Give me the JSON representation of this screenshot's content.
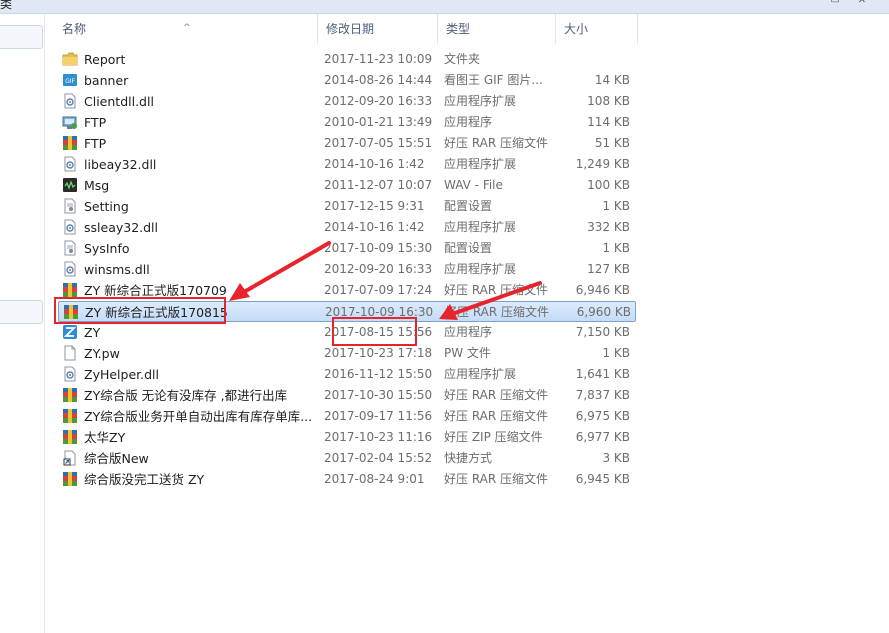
{
  "window": {
    "title_fragment": "类"
  },
  "columns": {
    "name": "名称",
    "date": "修改日期",
    "type": "类型",
    "size": "大小"
  },
  "files": [
    {
      "name": "Report",
      "date": "2017-11-23 10:09",
      "type": "文件夹",
      "size": "",
      "icon": "folder-icon"
    },
    {
      "name": "banner",
      "date": "2014-08-26 14:44",
      "type": "看图王 GIF 图片...",
      "size": "14 KB",
      "icon": "gif-icon"
    },
    {
      "name": "Clientdll.dll",
      "date": "2012-09-20 16:33",
      "type": "应用程序扩展",
      "size": "108 KB",
      "icon": "dll-icon"
    },
    {
      "name": "FTP",
      "date": "2010-01-21 13:49",
      "type": "应用程序",
      "size": "114 KB",
      "icon": "exe-icon"
    },
    {
      "name": "FTP",
      "date": "2017-07-05 15:51",
      "type": "好压 RAR 压缩文件",
      "size": "51 KB",
      "icon": "rar-icon"
    },
    {
      "name": "libeay32.dll",
      "date": "2014-10-16 1:42",
      "type": "应用程序扩展",
      "size": "1,249 KB",
      "icon": "dll-icon"
    },
    {
      "name": "Msg",
      "date": "2011-12-07 10:07",
      "type": "WAV - File",
      "size": "100 KB",
      "icon": "wav-icon"
    },
    {
      "name": "Setting",
      "date": "2017-12-15 9:31",
      "type": "配置设置",
      "size": "1 KB",
      "icon": "ini-icon"
    },
    {
      "name": "ssleay32.dll",
      "date": "2014-10-16 1:42",
      "type": "应用程序扩展",
      "size": "332 KB",
      "icon": "dll-icon"
    },
    {
      "name": "SysInfo",
      "date": "2017-10-09 15:30",
      "type": "配置设置",
      "size": "1 KB",
      "icon": "ini-icon"
    },
    {
      "name": "winsms.dll",
      "date": "2012-09-20 16:33",
      "type": "应用程序扩展",
      "size": "127 KB",
      "icon": "dll-icon"
    },
    {
      "name": "ZY 新综合正式版170709",
      "date": "2017-07-09 17:24",
      "type": "好压 RAR 压缩文件",
      "size": "6,946 KB",
      "icon": "rar-icon"
    },
    {
      "name": "ZY 新综合正式版170815",
      "date": "2017-10-09 16:30",
      "type": "好压 RAR 压缩文件",
      "size": "6,960 KB",
      "icon": "rar-icon",
      "selected": true
    },
    {
      "name": "ZY",
      "date": "2017-08-15 15:56",
      "type": "应用程序",
      "size": "7,150 KB",
      "icon": "zy-app-icon"
    },
    {
      "name": "ZY.pw",
      "date": "2017-10-23 17:18",
      "type": "PW 文件",
      "size": "1 KB",
      "icon": "blank-file-icon"
    },
    {
      "name": "ZyHelper.dll",
      "date": "2016-11-12 15:50",
      "type": "应用程序扩展",
      "size": "1,641 KB",
      "icon": "dll-icon"
    },
    {
      "name": "ZY综合版 无论有没库存 ,都进行出库",
      "date": "2017-10-30 15:50",
      "type": "好压 RAR 压缩文件",
      "size": "7,837 KB",
      "icon": "rar-icon"
    },
    {
      "name": "ZY综合版业务开单自动出库有库存单库...",
      "date": "2017-09-17 11:56",
      "type": "好压 RAR 压缩文件",
      "size": "6,975 KB",
      "icon": "rar-icon"
    },
    {
      "name": "太华ZY",
      "date": "2017-10-23 11:16",
      "type": "好压 ZIP 压缩文件",
      "size": "6,977 KB",
      "icon": "zip-icon"
    },
    {
      "name": "综合版New",
      "date": "2017-02-04 15:52",
      "type": "快捷方式",
      "size": "3 KB",
      "icon": "shortcut-icon"
    },
    {
      "name": "综合版没完工送货 ZY",
      "date": "2017-08-24 9:01",
      "type": "好压 RAR 压缩文件",
      "size": "6,945 KB",
      "icon": "rar-icon"
    }
  ],
  "colors": {
    "annotation_red": "#e8232c",
    "selection_border": "#7da2ce",
    "header_text": "#4c607a"
  }
}
